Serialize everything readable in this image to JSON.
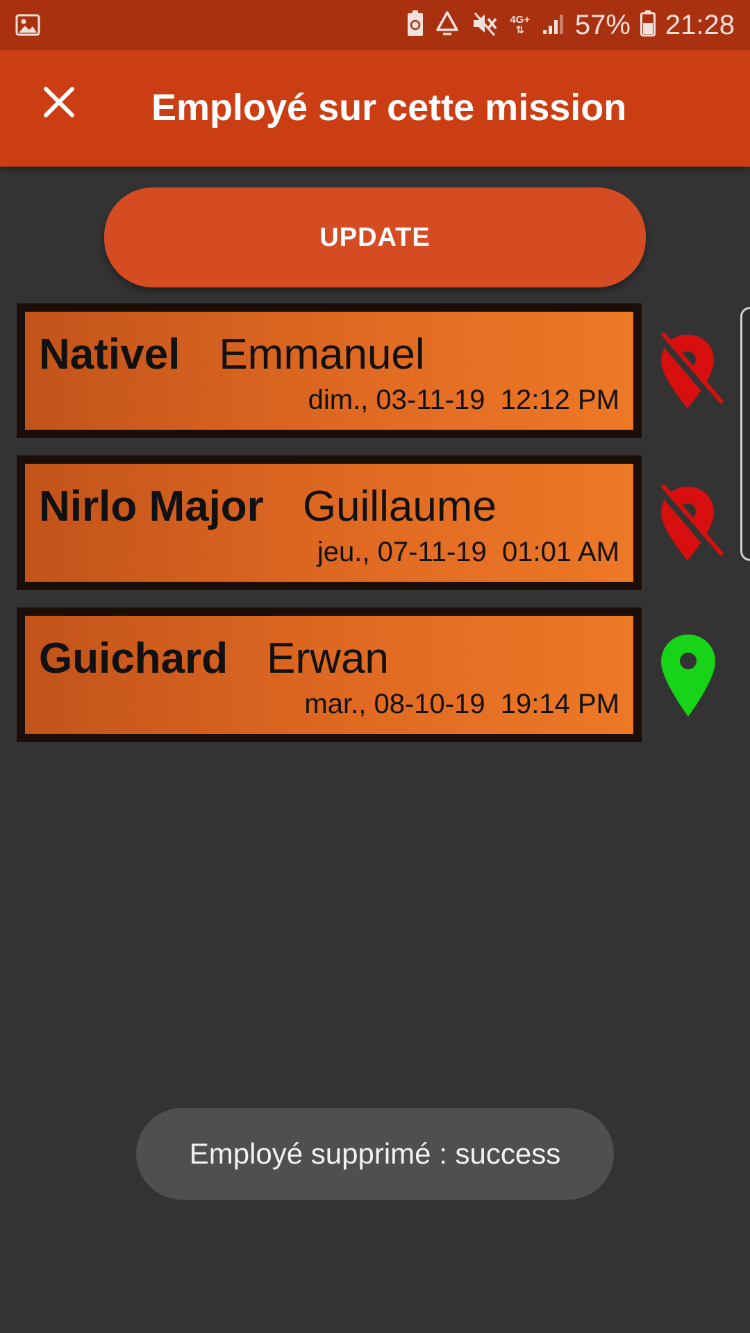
{
  "status_bar": {
    "network_label": "4G+",
    "battery_percent": "57%",
    "time": "21:28",
    "icons": [
      "gallery-icon",
      "battery-saver-icon",
      "recycle-icon",
      "vibrate-mute-icon",
      "network-4g-icon",
      "signal-icon",
      "battery-icon"
    ]
  },
  "appbar": {
    "title": "Employé sur cette mission",
    "close_icon": "close-icon"
  },
  "update_button": {
    "label": "UPDATE"
  },
  "employees": [
    {
      "last_name": "Nativel",
      "first_name": "Emmanuel",
      "datetime": "dim., 03-11-19  12:12 PM",
      "location_status": "location-off-icon",
      "pin_color": "#d80f0f"
    },
    {
      "last_name": "Nirlo Major",
      "first_name": "Guillaume",
      "datetime": "jeu., 07-11-19  01:01 AM",
      "location_status": "location-off-icon",
      "pin_color": "#d80f0f"
    },
    {
      "last_name": "Guichard",
      "first_name": "Erwan",
      "datetime": "mar., 08-10-19  19:14 PM",
      "location_status": "location-on-icon",
      "pin_color": "#18d418"
    }
  ],
  "toast": {
    "message": "Employé supprimé : success"
  },
  "colors": {
    "status_bar": "#a93110",
    "app_bar": "#cb3d12",
    "button": "#d54c22",
    "background": "#333333",
    "card_gradient_start": "#c2531a",
    "card_gradient_end": "#ed7826"
  }
}
